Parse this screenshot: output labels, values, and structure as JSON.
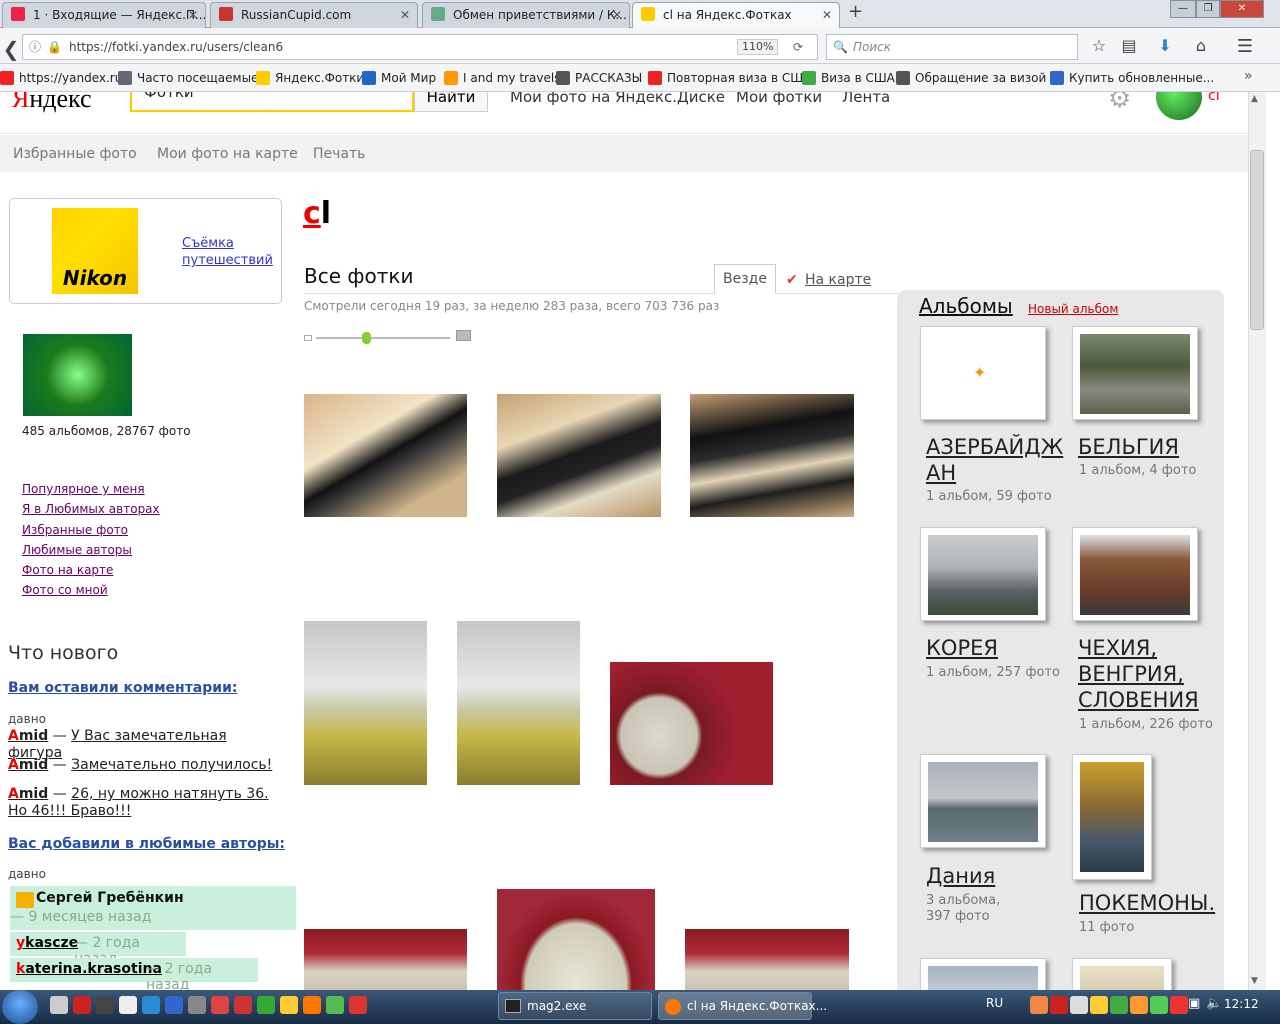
{
  "browser": {
    "tabs": [
      {
        "label": "1 · Входящие — Яндекс.П...",
        "icon": "mail-icon"
      },
      {
        "label": "RussianCupid.com",
        "icon": "heart-icon"
      },
      {
        "label": "Обмен приветствиями / К...",
        "icon": "flower-icon"
      },
      {
        "label": "cl на Яндекс.Фотках",
        "icon": "yandex-fotki-icon"
      }
    ],
    "url": "https://fotki.yandex.ru/users/clean6",
    "zoom": "110%",
    "search_placeholder": "Поиск",
    "bookmarks": [
      {
        "label": "https://yandex.ru/",
        "color": "#e22"
      },
      {
        "label": "Часто посещаемые",
        "color": "#667"
      },
      {
        "label": "Яндекс.Фотки",
        "color": "#fc0"
      },
      {
        "label": "Мой Мир",
        "color": "#26c"
      },
      {
        "label": "I and my travels",
        "color": "#f90"
      },
      {
        "label": "РАССКАЗЫ",
        "color": "#555"
      },
      {
        "label": "Повторная виза в СШ...",
        "color": "#e22"
      },
      {
        "label": "Виза в США",
        "color": "#4a4"
      },
      {
        "label": "Обращение за визой ...",
        "color": "#555"
      },
      {
        "label": "Купить обновленные...",
        "color": "#36c"
      }
    ]
  },
  "header": {
    "logo": "Яндекс",
    "search_tab": "Фотки",
    "search_button": "Найти",
    "links": [
      "Мои фото на Яндекс.Диске",
      "Мои фотки",
      "Лента"
    ],
    "user_letter": "cl"
  },
  "subnav": [
    "Избранные фото",
    "Мои фото на карте",
    "Печать"
  ],
  "sidebar": {
    "ad_brand": "Nikon",
    "ad_text": "Съёмка путешествий",
    "stats": "485 альбомов, 28767 фото",
    "links": [
      "Популярное у меня",
      "Я в Любимых авторах",
      "Избранные фото",
      "Любимые авторы",
      "Фото на карте",
      "Фото со мной"
    ],
    "whats_new": "Что нового",
    "comments_header": "Вам оставили комментарии:",
    "comments_time": "давно",
    "comments": [
      {
        "user_first": "A",
        "user_rest": "mid",
        "dash": " — ",
        "text": "У Вас замечательная фигура"
      },
      {
        "user_first": "A",
        "user_rest": "mid",
        "dash": " — ",
        "text": "Замечательно получилось!"
      },
      {
        "user_first": "A",
        "user_rest": "mid",
        "dash": " — ",
        "text": "26, ну можно натянуть 36. Но 46!!! Браво!!!"
      }
    ],
    "fav_header": "Вас добавили в любимые авторы:",
    "fav_time": "давно",
    "favs": [
      {
        "name": "Сергей Гребёнкин",
        "time": "— 9 месяцев назад"
      },
      {
        "first": "y",
        "rest": "kascze",
        "time": "— 2 года назад"
      },
      {
        "first": "k",
        "rest": "aterina.krasotina",
        "time": "— 2 года назад"
      }
    ]
  },
  "main": {
    "user_first": "c",
    "user_rest": "l",
    "all_photos": "Все фотки",
    "tab_everywhere": "Везде",
    "tab_map": "На карте",
    "views": "Смотрели сегодня 19 раз, за неделю 283 раза, всего 703 736 раз",
    "zoom_level": 0.35
  },
  "albums": {
    "title": "Альбомы",
    "new_album": "Новый альбом",
    "items": [
      {
        "title": "АЗЕРБАЙДЖАН",
        "sub": "1 альбом, 59 фото"
      },
      {
        "title": "БЕЛЬГИЯ",
        "sub": "1 альбом, 4 фото"
      },
      {
        "title": "КОРЕЯ",
        "sub": "1 альбом, 257 фото"
      },
      {
        "title": "ЧЕХИЯ, ВЕНГРИЯ, СЛОВЕНИЯ",
        "sub": "1 альбом, 226 фото"
      },
      {
        "title": "Дания",
        "sub": "3 альбома, 397 фото"
      },
      {
        "title": "ПОКЕМОНЫ.",
        "sub": "11 фото"
      }
    ]
  },
  "taskbar": {
    "tasks": [
      "mag2.exe",
      "cl на Яндекс.Фотках..."
    ],
    "lang": "RU",
    "time": "12:12"
  }
}
